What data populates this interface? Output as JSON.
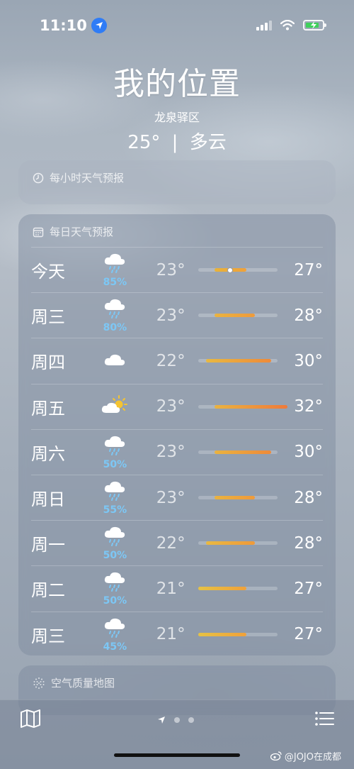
{
  "status_bar": {
    "time": "11:10",
    "location_active": true,
    "battery_charging": true
  },
  "header": {
    "location_title": "我的位置",
    "district": "龙泉驿区",
    "temperature": "25°",
    "separator": "|",
    "condition": "多云"
  },
  "hourly_card": {
    "icon": "clock-icon",
    "title": "每小时天气预报"
  },
  "daily_card": {
    "icon": "calendar-icon",
    "title": "每日天气预报",
    "range": {
      "min": 21,
      "max": 32
    },
    "days": [
      {
        "day": "今天",
        "icon": "rain-cloud-icon",
        "precip": "85%",
        "low": "23°",
        "high": "27°",
        "low_val": 23,
        "high_val": 27,
        "current": 25,
        "colors": [
          "#e8b33a",
          "#f0a13a"
        ]
      },
      {
        "day": "周三",
        "icon": "rain-cloud-icon",
        "precip": "80%",
        "low": "23°",
        "high": "28°",
        "low_val": 23,
        "high_val": 28,
        "colors": [
          "#eab340",
          "#ef9a3a"
        ]
      },
      {
        "day": "周四",
        "icon": "cloud-icon",
        "precip": "",
        "low": "22°",
        "high": "30°",
        "low_val": 22,
        "high_val": 30,
        "colors": [
          "#e9b941",
          "#ee8a39"
        ]
      },
      {
        "day": "周五",
        "icon": "partly-sunny-icon",
        "precip": "",
        "low": "23°",
        "high": "32°",
        "low_val": 23,
        "high_val": 32,
        "colors": [
          "#eab340",
          "#ef7a3a"
        ]
      },
      {
        "day": "周六",
        "icon": "rain-cloud-icon",
        "precip": "50%",
        "low": "23°",
        "high": "30°",
        "low_val": 23,
        "high_val": 30,
        "colors": [
          "#eab340",
          "#ee8a39"
        ]
      },
      {
        "day": "周日",
        "icon": "rain-cloud-icon",
        "precip": "55%",
        "low": "23°",
        "high": "28°",
        "low_val": 23,
        "high_val": 28,
        "colors": [
          "#eab340",
          "#ef9a3a"
        ]
      },
      {
        "day": "周一",
        "icon": "rain-cloud-icon",
        "precip": "50%",
        "low": "22°",
        "high": "28°",
        "low_val": 22,
        "high_val": 28,
        "colors": [
          "#e9b941",
          "#ef9a3a"
        ]
      },
      {
        "day": "周二",
        "icon": "rain-cloud-icon",
        "precip": "50%",
        "low": "21°",
        "high": "27°",
        "low_val": 21,
        "high_val": 27,
        "colors": [
          "#e6c244",
          "#f0a13a"
        ]
      },
      {
        "day": "周三",
        "icon": "rain-cloud-icon",
        "precip": "45%",
        "low": "21°",
        "high": "27°",
        "low_val": 21,
        "high_val": 27,
        "colors": [
          "#e6c244",
          "#f0a13a"
        ]
      }
    ]
  },
  "air_card": {
    "icon": "air-quality-icon",
    "title": "空气质量地图"
  },
  "bottom_bar": {
    "page_count": 3,
    "active_page": 0
  },
  "watermark": "@JOJO在成都"
}
